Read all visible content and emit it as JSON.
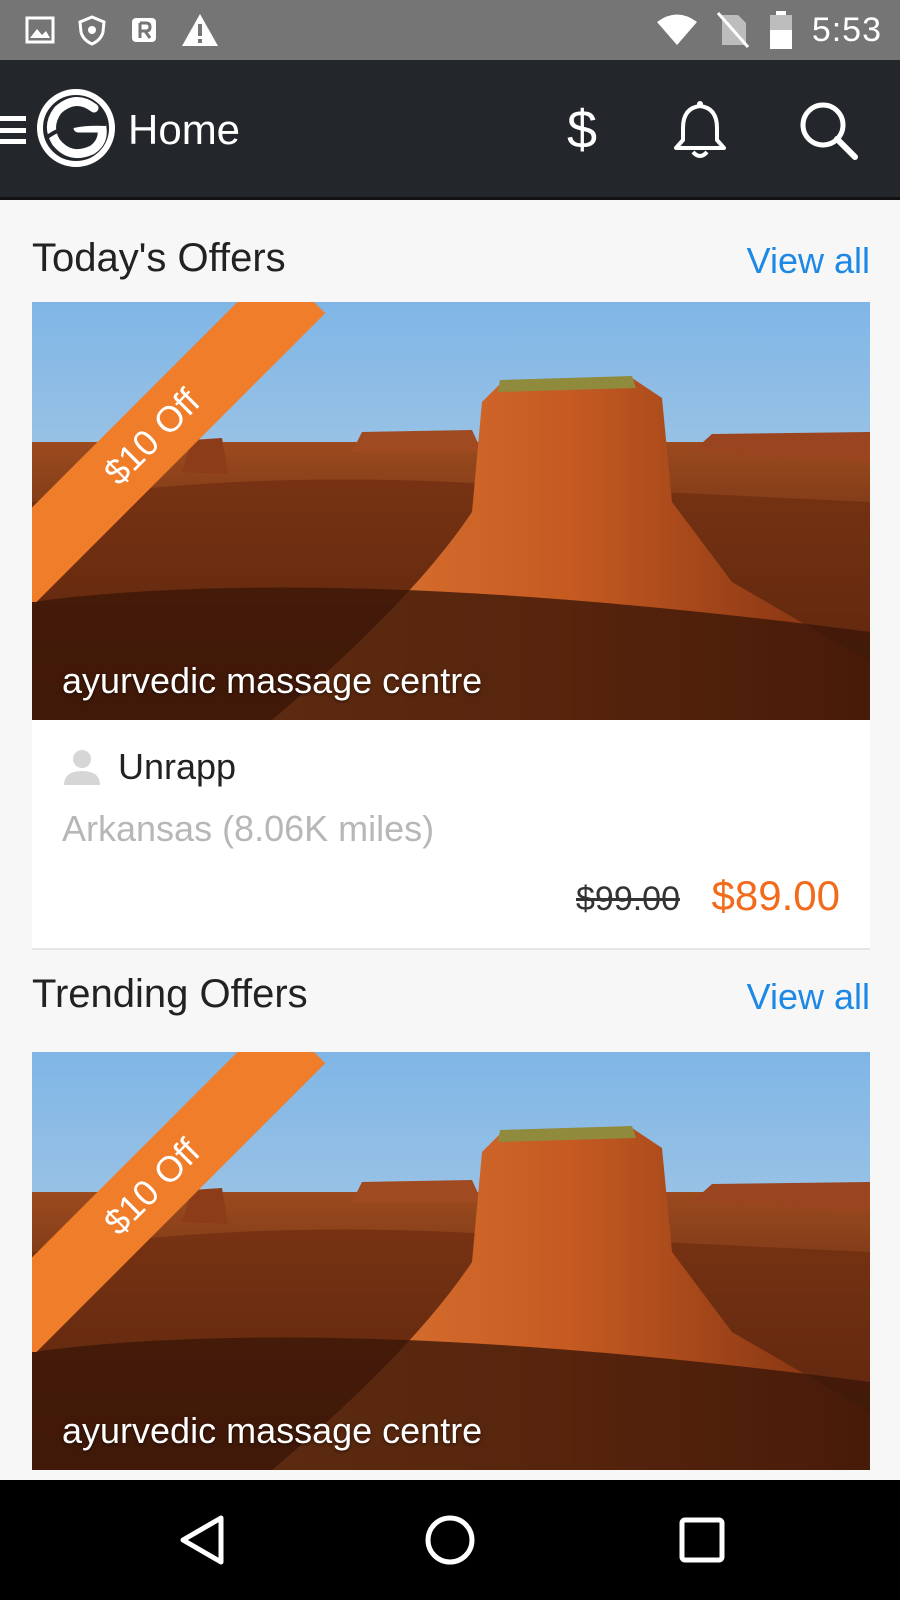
{
  "status_bar": {
    "time": "5:53",
    "icons": [
      "image-icon",
      "shield-icon",
      "r-badge-icon",
      "warning-icon",
      "wifi-icon",
      "no-sim-icon",
      "battery-icon"
    ]
  },
  "app_bar": {
    "title": "Home",
    "dollar_symbol": "$",
    "icons": [
      "menu-icon",
      "logo-icon",
      "dollar-icon",
      "bell-icon",
      "search-icon"
    ]
  },
  "sections": [
    {
      "title": "Today's Offers",
      "view_all": "View all",
      "card": {
        "discount": "$10 Off",
        "caption": "ayurvedic massage centre",
        "vendor": "Unrapp",
        "location": "Arkansas (8.06K miles)",
        "old_price": "$99.00",
        "new_price": "$89.00"
      }
    },
    {
      "title": "Trending Offers",
      "view_all": "View all",
      "card": {
        "discount": "$10 Off",
        "caption": "ayurvedic massage centre"
      }
    }
  ],
  "nav_bar": {
    "icons": [
      "back-icon",
      "home-icon",
      "recents-icon"
    ]
  },
  "colors": {
    "app_bar": "#23272b",
    "status_bar": "#757575",
    "link": "#1e88e5",
    "ribbon": "#ef7d2a",
    "price": "#f26a1b"
  }
}
